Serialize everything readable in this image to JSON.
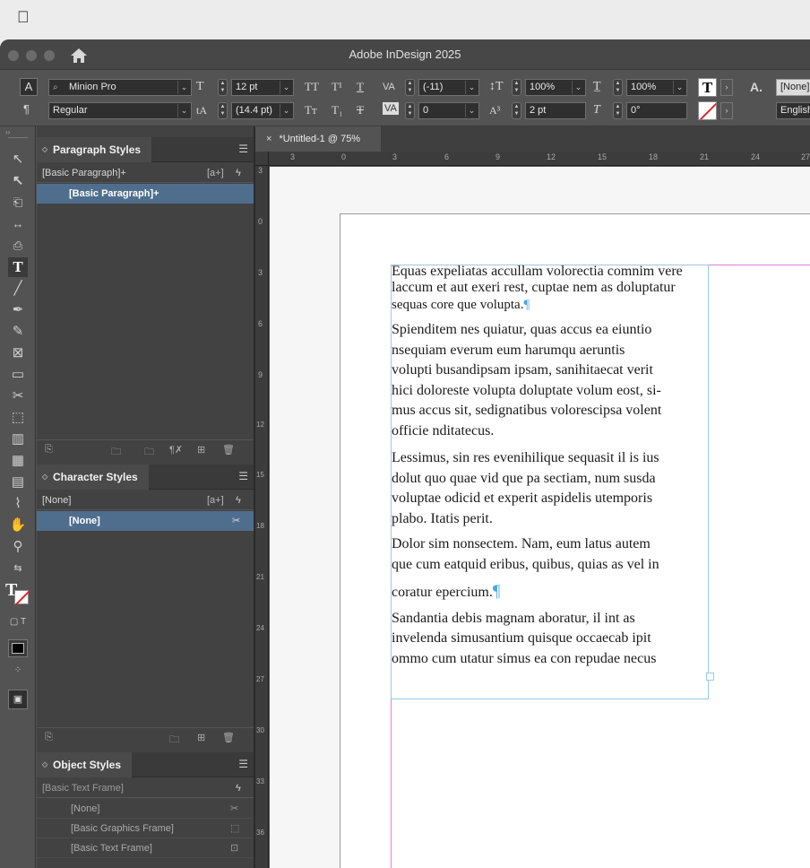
{
  "menubar": {
    "apple": ""
  },
  "app": {
    "title": "Adobe InDesign 2025"
  },
  "control": {
    "char_btn": "A",
    "para_btn": "¶",
    "font_family": "Minion Pro",
    "font_style": "Regular",
    "font_size": "12 pt",
    "leading": "(14.4 pt)",
    "kerning": "(-11)",
    "tracking": "0",
    "vscale": "100%",
    "hscale": "100%",
    "baseline": "2 pt",
    "skew": "0°",
    "char_style": "[None]",
    "language": "English"
  },
  "paragraph_styles": {
    "tab": "Paragraph Styles",
    "current": "[Basic Paragraph]+",
    "new_group_btn": "[a+]",
    "items": [
      "[Basic Paragraph]+"
    ]
  },
  "character_styles": {
    "tab": "Character Styles",
    "current": "[None]",
    "new_group_btn": "[a+]",
    "items": [
      "[None]"
    ]
  },
  "object_styles": {
    "tab": "Object Styles",
    "current": "[Basic Text Frame]",
    "items": [
      "[None]",
      "[Basic Graphics Frame]",
      "[Basic Text Frame]"
    ]
  },
  "document": {
    "tab": "*Untitled-1 @ 75%",
    "close": "×",
    "hruler": [
      "3",
      "0",
      "3",
      "6",
      "9",
      "12",
      "15",
      "18",
      "21",
      "24",
      "27"
    ],
    "vruler": [
      "3",
      "0",
      "3",
      "6",
      "9",
      "12",
      "15",
      "18",
      "21",
      "24",
      "27",
      "30",
      "33",
      "36"
    ]
  },
  "story": {
    "p1": [
      "Equas expeliatas accullam volorectia comnim vere",
      "laccum et aut exeri rest, cuptae nem as doluptatur",
      "sequas core que volupta."
    ],
    "p2": [
      "Spienditem nes quiatur, quas accus ea eiuntio",
      "nsequiam everum eum harumqu aeruntis",
      "volupti busandipsam ipsam, sanihitaecat verit",
      "hici doloreste volupta doluptate volum eost, si-",
      "mus accus sit, sedignatibus volorescipsa volent",
      "officie nditatecus."
    ],
    "p3": [
      "Lessimus, sin res evenihilique sequasit il is ius",
      "dolut quo quae vid que pa sectiam, num susda",
      "voluptae odicid et experit aspidelis utemporis",
      "plabo. Itatis perit."
    ],
    "p4": [
      "Dolor sim nonsectem. Nam, eum latus autem",
      "que cum eatquid eribus, quibus, quias as vel in",
      "coratur epercium."
    ],
    "p5": [
      "Sandantia debis magnam aboratur, il int as",
      "invelenda simusantium quisque occaecab ipit",
      "ommo cum utatur simus ea con repudae necus"
    ],
    "pilcrow": "¶"
  }
}
